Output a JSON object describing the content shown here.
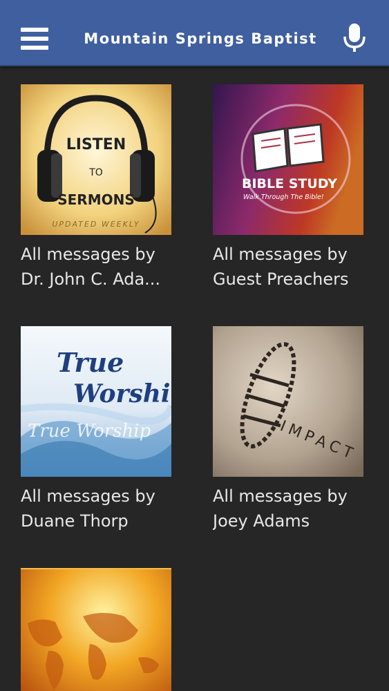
{
  "header": {
    "title": "Mountain Springs Baptist",
    "menu_icon": "hamburger-menu-icon",
    "mic_icon": "microphone-icon",
    "background": "#3f5f9f"
  },
  "series": [
    {
      "line1": "All messages by",
      "line2": "Dr. John C. Ada...",
      "art": {
        "title": "LISTEN",
        "middle": "TO",
        "bottom": "SERMONS",
        "footer": "UPDATED WEEKLY"
      }
    },
    {
      "line1": "All messages by",
      "line2": "Guest Preachers",
      "art": {
        "title": "BIBLE STUDY",
        "subtitle": "Walk Through The Bible!"
      }
    },
    {
      "line1": "All messages by",
      "line2": "Duane Thorp",
      "art": {
        "title_top": "True",
        "title_bottom": "Worship",
        "echo": "True Worship"
      }
    },
    {
      "line1": "All messages by",
      "line2": "Joey Adams",
      "art": {
        "title": "IMPACT"
      }
    },
    {
      "line1": "",
      "line2": "",
      "art": {}
    }
  ]
}
